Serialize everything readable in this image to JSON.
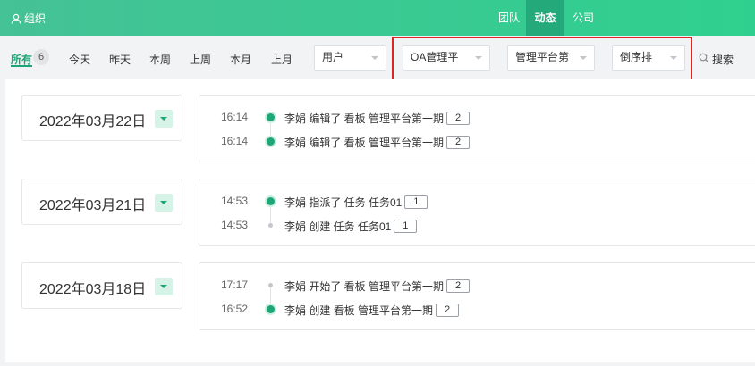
{
  "header": {
    "org_label": "组织",
    "nav": [
      {
        "label": "团队"
      },
      {
        "label": "动态"
      },
      {
        "label": "公司"
      }
    ]
  },
  "filters": {
    "tabs": [
      {
        "label": "所有",
        "count": "6"
      },
      {
        "label": "今天"
      },
      {
        "label": "昨天"
      },
      {
        "label": "本周"
      },
      {
        "label": "上周"
      },
      {
        "label": "本月"
      },
      {
        "label": "上月"
      }
    ],
    "user_select": "用户",
    "project_select": "OA管理平",
    "board_select": "管理平台第",
    "order_select": "倒序排",
    "search_label": "搜索"
  },
  "groups": [
    {
      "date": "2022年03月22日",
      "events": [
        {
          "time": "16:14",
          "text": "李娟 编辑了 看板 管理平台第一期",
          "count": "2"
        },
        {
          "time": "16:14",
          "text": "李娟 编辑了 看板 管理平台第一期",
          "count": "2"
        }
      ]
    },
    {
      "date": "2022年03月21日",
      "events": [
        {
          "time": "14:53",
          "text": "李娟 指派了 任务 任务01",
          "count": "1"
        },
        {
          "time": "14:53",
          "text": "李娟 创建 任务 任务01",
          "count": "1"
        }
      ]
    },
    {
      "date": "2022年03月18日",
      "events": [
        {
          "time": "17:17",
          "text": "李娟 开始了 看板 管理平台第一期",
          "count": "2"
        },
        {
          "time": "16:52",
          "text": "李娟 创建 看板 管理平台第一期",
          "count": "2"
        }
      ]
    }
  ],
  "colors": {
    "accent": "#1ea776",
    "header_start": "#45c296",
    "highlight_box": "#e02424"
  }
}
